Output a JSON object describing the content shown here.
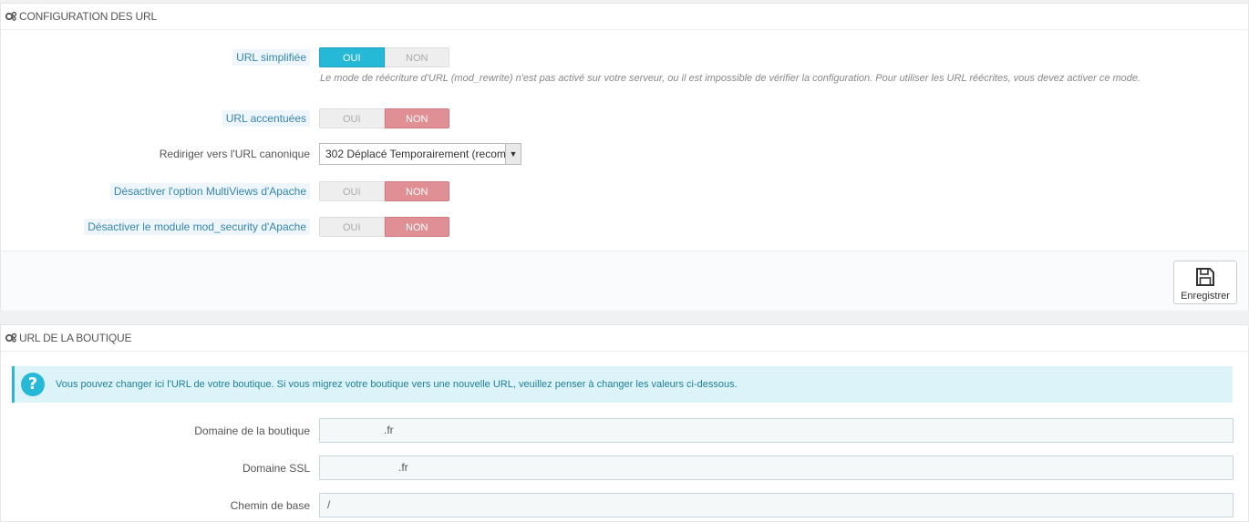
{
  "section1": {
    "title": "CONFIGURATION DES URL",
    "friendly_url": {
      "label": "URL simplifiée",
      "yes": "OUI",
      "no": "NON",
      "help": "Le mode de réécriture d'URL (mod_rewrite) n'est pas activé sur votre serveur, ou il est impossible de vérifier la configuration. Pour utiliser les URL réécrites, vous devez activer ce mode."
    },
    "accented_url": {
      "label": "URL accentuées",
      "yes": "OUI",
      "no": "NON"
    },
    "canonical_redirect": {
      "label": "Rediriger vers l'URL canonique",
      "value": "302 Déplacé Temporairement (recom"
    },
    "multiviews": {
      "label": "Désactiver l'option MultiViews d'Apache",
      "yes": "OUI",
      "no": "NON"
    },
    "mod_security": {
      "label": "Désactiver le module mod_security d'Apache",
      "yes": "OUI",
      "no": "NON"
    },
    "save_label": "Enregistrer"
  },
  "section2": {
    "title": "URL DE LA BOUTIQUE",
    "alert": "Vous pouvez changer ici l'URL de votre boutique. Si vous migrez votre boutique vers une nouvelle URL, veuillez penser à changer les valeurs ci-dessous.",
    "shop_domain": {
      "label": "Domaine de la boutique",
      "value": ".fr"
    },
    "ssl_domain": {
      "label": "Domaine SSL",
      "value": ".fr"
    },
    "base_uri": {
      "label": "Chemin de base",
      "value": "/"
    }
  },
  "colors": {
    "accent": "#25b9d7",
    "danger": "#e08f95"
  },
  "icons": {
    "section": "gears-icon",
    "save": "floppy-disk-icon",
    "info": "question-circle-icon"
  }
}
